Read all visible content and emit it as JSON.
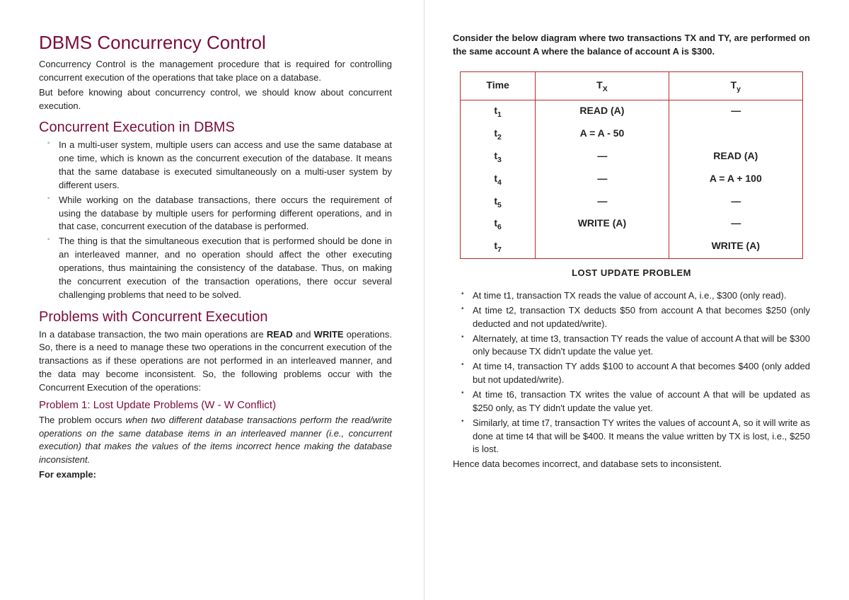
{
  "left": {
    "title": "DBMS Concurrency Control",
    "intro1": "Concurrency Control is the management procedure that is required for controlling concurrent execution of the operations that take place on a database.",
    "intro2": "But before knowing about concurrency control, we should know about concurrent execution.",
    "h2a": "Concurrent Execution in DBMS",
    "li1": "In a multi-user system, multiple users can access and use the same database at one time, which is known as the concurrent execution of the database. It means that the same database is executed simultaneously on a multi-user system by different users.",
    "li2": "While working on the database transactions, there occurs the requirement of using the database by multiple users for performing different operations, and in that case, concurrent execution of the database is performed.",
    "li3": "The thing is that the simultaneous execution that is performed should be done in an interleaved manner, and no operation should affect the other executing operations, thus maintaining the consistency of the database. Thus, on making the concurrent execution of the transaction operations, there occur several challenging problems that need to be solved.",
    "h2b": "Problems with Concurrent Execution",
    "p2b_a": "In a database transaction, the two main operations are ",
    "p2b_read": "READ",
    "p2b_mid": " and ",
    "p2b_write": "WRITE",
    "p2b_b": " operations. So, there is a need to manage these two operations in the concurrent execution of the transactions as if these operations are not performed in an interleaved manner, and the data may become inconsistent. So, the following problems occur with the Concurrent Execution of the operations:",
    "h3": "Problem 1: Lost Update Problems (W - W Conflict)",
    "p3a": "The problem occurs ",
    "p3b": "when two different database transactions perform the read/write operations on the same database items in an interleaved manner (i.e., concurrent execution) that makes the values of the items incorrect hence making the database inconsistent.",
    "p3c": "For example:"
  },
  "right": {
    "intro": "Consider the below diagram where two transactions TX and TY, are performed on the same account A where the balance of account A is $300.",
    "table": {
      "headers": {
        "time": "Time",
        "tx": "Tx",
        "ty": "Ty"
      },
      "rows": [
        {
          "t": "t",
          "s": "1",
          "tx": "READ (A)",
          "ty": "—"
        },
        {
          "t": "t",
          "s": "2",
          "tx": "A = A - 50",
          "ty": ""
        },
        {
          "t": "t",
          "s": "3",
          "tx": "—",
          "ty": "READ (A)"
        },
        {
          "t": "t",
          "s": "4",
          "tx": "—",
          "ty": "A = A + 100"
        },
        {
          "t": "t",
          "s": "5",
          "tx": "—",
          "ty": "—"
        },
        {
          "t": "t",
          "s": "6",
          "tx": "WRITE (A)",
          "ty": "—"
        },
        {
          "t": "t",
          "s": "7",
          "tx": "",
          "ty": "WRITE (A)"
        }
      ],
      "caption": "LOST UPDATE  PROBLEM"
    },
    "b1": "At time t1, transaction TX reads the value of account A, i.e., $300 (only read).",
    "b2": "At time t2, transaction TX deducts $50 from account A that becomes $250 (only deducted and not updated/write).",
    "b3": "Alternately, at time t3, transaction TY reads the value of account A that will be $300 only because TX didn't update the value yet.",
    "b4": "At time t4, transaction TY adds $100 to account A that becomes $400 (only added but not updated/write).",
    "b5": "At time t6, transaction TX writes the value of account A that will be updated as $250 only, as TY didn't update the value yet.",
    "b6": "Similarly, at time t7, transaction TY writes the values of account A, so it will write as done at time t4 that will be $400. It means the value written by TX is lost, i.e., $250 is lost.",
    "concl": "Hence data becomes incorrect, and database sets to inconsistent."
  }
}
